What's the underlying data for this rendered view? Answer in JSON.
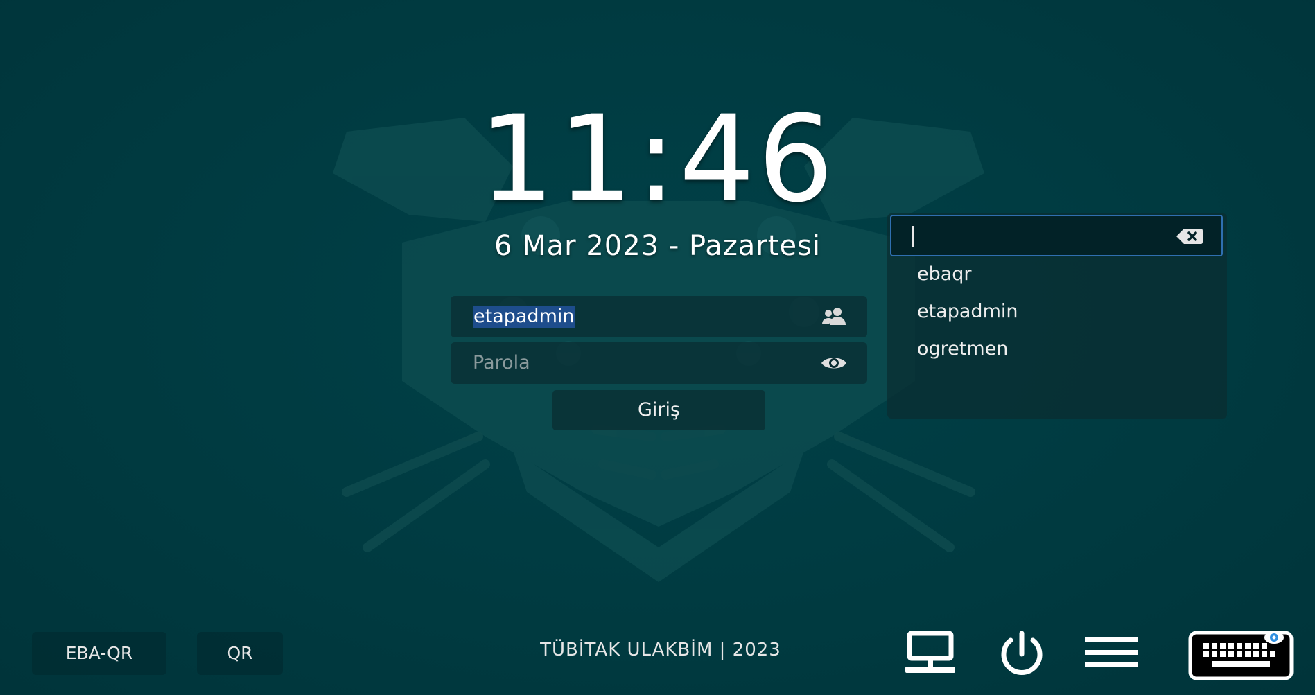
{
  "clock": {
    "time": "11:46"
  },
  "date": {
    "text": "6 Mar 2023 - Pazartesi"
  },
  "login": {
    "username_value": "etapadmin",
    "users_icon": "users-icon",
    "password_placeholder": "Parola",
    "show_password_icon": "eye-icon",
    "submit_label": "Giriş"
  },
  "user_dropdown": {
    "search_value": "",
    "clear_icon": "backspace-clear-icon",
    "users": [
      "ebaqr",
      "etapadmin",
      "ogretmen"
    ]
  },
  "bottom_bar": {
    "eba_qr_label": "EBA-QR",
    "qr_label": "QR",
    "footer_text": "TÜBİTAK ULAKBİM | 2023",
    "network_icon": "network-computer-icon",
    "power_icon": "power-icon",
    "menu_icon": "hamburger-menu-icon",
    "keyboard_icon": "onscreen-keyboard-icon"
  },
  "colors": {
    "background": "#003a40",
    "selection": "#1e4d8c",
    "focus_border": "#2f6fb0"
  }
}
